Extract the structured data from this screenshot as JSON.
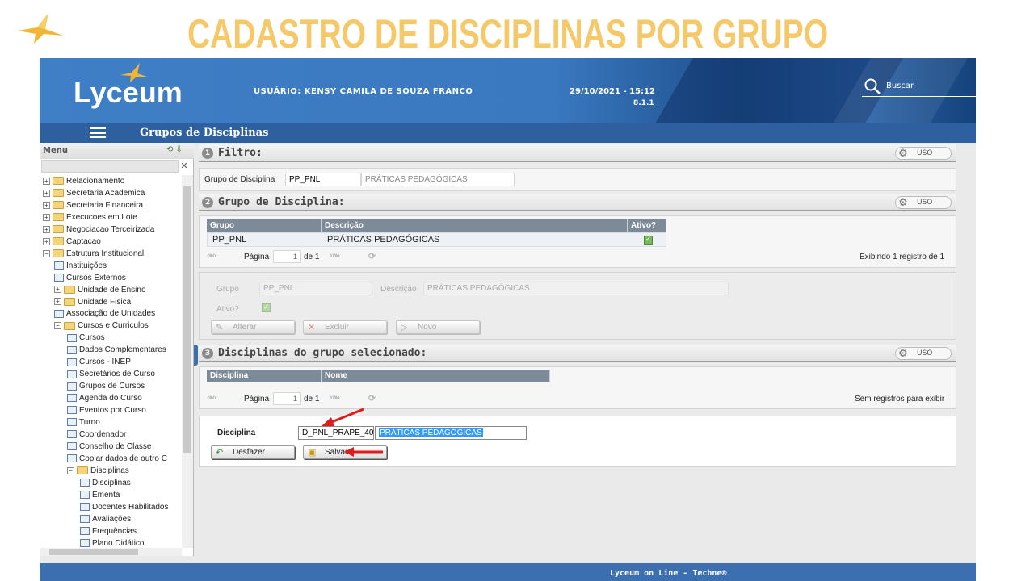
{
  "slide": {
    "title": "CADASTRO DE DISCIPLINAS POR GRUPO"
  },
  "header": {
    "logo": "Lyceum",
    "user_label": "USUÁRIO: KENSY CAMILA DE SOUZA FRANCO",
    "datetime": "29/10/2021 - 15:12",
    "version": "8.1.1",
    "search_placeholder": "Buscar"
  },
  "subbar": {
    "title": "Grupos de Disciplinas"
  },
  "sidebar": {
    "menu_label": "Menu",
    "items": [
      {
        "label": "Relacionamento",
        "level": 0,
        "type": "folder",
        "expander": "+"
      },
      {
        "label": "Secretaria Academica",
        "level": 0,
        "type": "folder",
        "expander": "+"
      },
      {
        "label": "Secretaria Financeira",
        "level": 0,
        "type": "folder",
        "expander": "+"
      },
      {
        "label": "Execucoes em Lote",
        "level": 0,
        "type": "folder",
        "expander": "+"
      },
      {
        "label": "Negociacao Terceirizada",
        "level": 0,
        "type": "folder",
        "expander": "+"
      },
      {
        "label": "Captacao",
        "level": 0,
        "type": "folder",
        "expander": "+"
      },
      {
        "label": "Estrutura Institucional",
        "level": 0,
        "type": "folder",
        "expander": "−"
      },
      {
        "label": "Instituições",
        "level": 1,
        "type": "doc"
      },
      {
        "label": "Cursos Externos",
        "level": 1,
        "type": "doc"
      },
      {
        "label": "Unidade de Ensino",
        "level": 1,
        "type": "folder",
        "expander": "+"
      },
      {
        "label": "Unidade Fisica",
        "level": 1,
        "type": "folder",
        "expander": "+"
      },
      {
        "label": "Associação de Unidades",
        "level": 1,
        "type": "doc"
      },
      {
        "label": "Cursos e Curriculos",
        "level": 1,
        "type": "folder",
        "expander": "−"
      },
      {
        "label": "Cursos",
        "level": 2,
        "type": "doc"
      },
      {
        "label": "Dados Complementares",
        "level": 2,
        "type": "doc"
      },
      {
        "label": "Cursos - INEP",
        "level": 2,
        "type": "doc"
      },
      {
        "label": "Secretários de Curso",
        "level": 2,
        "type": "doc"
      },
      {
        "label": "Grupos de Cursos",
        "level": 2,
        "type": "doc"
      },
      {
        "label": "Agenda do Curso",
        "level": 2,
        "type": "doc"
      },
      {
        "label": "Eventos por Curso",
        "level": 2,
        "type": "doc"
      },
      {
        "label": "Turno",
        "level": 2,
        "type": "doc"
      },
      {
        "label": "Coordenador",
        "level": 2,
        "type": "doc"
      },
      {
        "label": "Conselho de Classe",
        "level": 2,
        "type": "doc"
      },
      {
        "label": "Copiar dados de outro C",
        "level": 2,
        "type": "doc"
      },
      {
        "label": "Disciplinas",
        "level": 2,
        "type": "folder",
        "expander": "−"
      },
      {
        "label": "Disciplinas",
        "level": 3,
        "type": "doc"
      },
      {
        "label": "Ementa",
        "level": 3,
        "type": "doc"
      },
      {
        "label": "Docentes Habilitados",
        "level": 3,
        "type": "doc"
      },
      {
        "label": "Avaliações",
        "level": 3,
        "type": "doc"
      },
      {
        "label": "Frequências",
        "level": 3,
        "type": "doc"
      },
      {
        "label": "Plano Didático",
        "level": 3,
        "type": "doc"
      }
    ]
  },
  "sections": {
    "filtro": {
      "num": "1",
      "title": "Filtro:",
      "uso": "USO"
    },
    "grupo": {
      "num": "2",
      "title": "Grupo de Disciplina:",
      "uso": "USO"
    },
    "disciplinas": {
      "num": "3",
      "title": "Disciplinas do grupo selecionado:",
      "uso": "USO"
    }
  },
  "filtro": {
    "label": "Grupo de Disciplina",
    "code": "PP_PNL",
    "description": "PRÁTICAS PEDAGÓGICAS"
  },
  "grupo_grid": {
    "columns": [
      "Grupo",
      "Descrição",
      "Ativo?"
    ],
    "rows": [
      {
        "grupo": "PP_PNL",
        "descricao": "PRÁTICAS PEDAGÓGICAS",
        "ativo": true
      }
    ],
    "pager": {
      "page_label": "Página",
      "page": "1",
      "of_label": "de 1",
      "status": "Exibindo 1 registro de 1"
    }
  },
  "grupo_detail": {
    "grupo_label": "Grupo",
    "grupo_value": "PP_PNL",
    "descricao_label": "Descrição",
    "descricao_value": "PRÁTICAS PEDAGÓGICAS",
    "ativo_label": "Ativo?",
    "buttons": {
      "alterar": "Alterar",
      "excluir": "Excluir",
      "novo": "Novo"
    }
  },
  "disc_grid": {
    "columns": [
      "Disciplina",
      "Nome"
    ],
    "pager": {
      "page_label": "Página",
      "page": "1",
      "of_label": "de 1",
      "status": "Sem registros para exibir"
    }
  },
  "disc_form": {
    "label": "Disciplina",
    "code": "D_PNL_PRAPE_400",
    "name": "PRÁTICAS PEDAGÓGICAS",
    "buttons": {
      "desfazer": "Desfazer",
      "salvar": "Salvar"
    }
  },
  "footer": {
    "text": "Lyceum on Line - Techne®"
  },
  "colors": {
    "title": "#f5c869",
    "header": "#3f7fc6",
    "subbar": "#2e5f9e",
    "annotation_arrow": "#e01b1b",
    "highlight": "#3399ff"
  }
}
